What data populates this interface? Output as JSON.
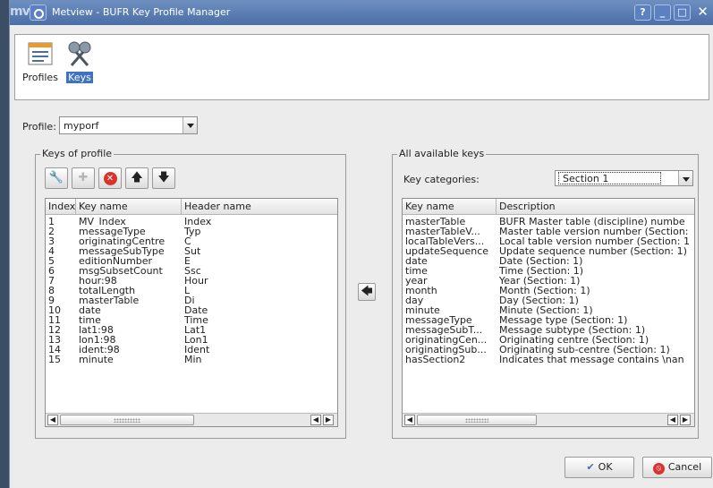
{
  "window": {
    "logo": "mv",
    "title": "Metview - BUFR Key Profile Manager",
    "help_label": "?",
    "minimize_label": "_",
    "maximize_label": "□",
    "close_label": "✕"
  },
  "toolbar": {
    "profiles_label": "Profiles",
    "keys_label": "Keys",
    "selected": "Keys"
  },
  "profile": {
    "label": "Profile:",
    "value": "myporf"
  },
  "keys_of_profile": {
    "title": "Keys of profile",
    "buttons": [
      "edit",
      "add",
      "delete",
      "move-up",
      "move-down"
    ],
    "columns": [
      "Index",
      "Key name",
      "Header name"
    ],
    "rows": [
      [
        "1",
        "MV_Index",
        "Index"
      ],
      [
        "2",
        "messageType",
        "Typ"
      ],
      [
        "3",
        "originatingCentre",
        "C"
      ],
      [
        "4",
        "messageSubType",
        "Sut"
      ],
      [
        "5",
        "editionNumber",
        "E"
      ],
      [
        "6",
        "msgSubsetCount",
        "Ssc"
      ],
      [
        "7",
        "hour:98",
        "Hour"
      ],
      [
        "8",
        "totalLength",
        "L"
      ],
      [
        "9",
        "masterTable",
        "Di"
      ],
      [
        "10",
        "date",
        "Date"
      ],
      [
        "11",
        "time",
        "Time"
      ],
      [
        "12",
        "lat1:98",
        "Lat1"
      ],
      [
        "13",
        "lon1:98",
        "Lon1"
      ],
      [
        "14",
        "ident:98",
        "Ident"
      ],
      [
        "15",
        "minute",
        "Min"
      ]
    ]
  },
  "all_keys": {
    "title": "All available keys",
    "categories_label": "Key categories:",
    "category_value": "Section 1",
    "columns": [
      "Key name",
      "Description"
    ],
    "rows": [
      [
        "masterTable",
        "BUFR Master table (discipline) numbe"
      ],
      [
        "masterTableV...",
        "Master table version number (Section:"
      ],
      [
        "localTableVers...",
        "Local table version number (Section: 1"
      ],
      [
        "updateSequence",
        "Update sequence number (Section: 1)"
      ],
      [
        "date",
        "Date (Section: 1)"
      ],
      [
        "time",
        "Time (Section: 1)"
      ],
      [
        "year",
        "Year (Section: 1)"
      ],
      [
        "month",
        "Month (Section: 1)"
      ],
      [
        "day",
        "Day (Section: 1)"
      ],
      [
        "minute",
        "Minute (Section: 1)"
      ],
      [
        "messageType",
        "Message type (Section: 1)"
      ],
      [
        "messageSubT...",
        "Message subtype (Section: 1)"
      ],
      [
        "originatingCen...",
        "Originating centre (Section: 1)"
      ],
      [
        "originatingSub...",
        "Originating sub-centre (Section: 1)"
      ],
      [
        "hasSection2",
        "Indicates that message contains \\nan"
      ]
    ]
  },
  "dialog": {
    "ok_label": "OK",
    "cancel_label": "Cancel"
  },
  "colors": {
    "titlebar": "#5a7db5",
    "selection": "#3f71c4",
    "window_bg": "#ececec"
  }
}
